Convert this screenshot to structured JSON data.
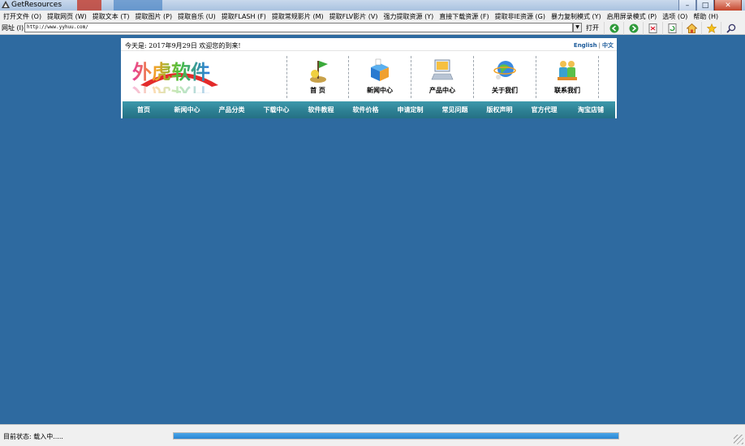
{
  "window": {
    "title": "GetResources"
  },
  "menu": {
    "items": [
      "打开文件 (O)",
      "提取网页 (W)",
      "提取文本 (T)",
      "提取图片 (P)",
      "提取音乐 (U)",
      "提取FLASH (F)",
      "提取常规影片 (M)",
      "提取FLV影片 (V)",
      "强力提取资源 (Y)",
      "直接下载资源 (F)",
      "提取非IE资源 (G)",
      "暴力复制模式 (Y)",
      "启用屏录模式 (P)",
      "选项 (O)",
      "帮助 (H)"
    ]
  },
  "address": {
    "label": "网址 (I)",
    "value": "http://www.yyhuu.com/",
    "open_label": "打开"
  },
  "toolbar": {
    "icons": [
      "back-icon",
      "forward-icon",
      "save-page-icon",
      "refresh-icon",
      "home-icon",
      "favorite-icon",
      "search-icon"
    ]
  },
  "site": {
    "date_text": "今天是: 2017年9月29日  欢迎您的到来!",
    "lang_en": "English",
    "lang_sep": "|",
    "lang_cn": "中文",
    "logo_text": "外虎软件",
    "icon_nav": [
      "首  页",
      "新闻中心",
      "产品中心",
      "关于我们",
      "联系我们"
    ],
    "main_nav": [
      "首页",
      "新闻中心",
      "产品分类",
      "下载中心",
      "软件教程",
      "软件价格",
      "申请定制",
      "常见问题",
      "版权声明",
      "官方代理",
      "淘宝店铺"
    ]
  },
  "status": {
    "text": "目前状态: 载入中.....",
    "progress": 1.0
  },
  "colors": {
    "content_bg": "#2e6aa0",
    "nav_bg": "#2c7e92",
    "progress": "#2a86d4"
  }
}
